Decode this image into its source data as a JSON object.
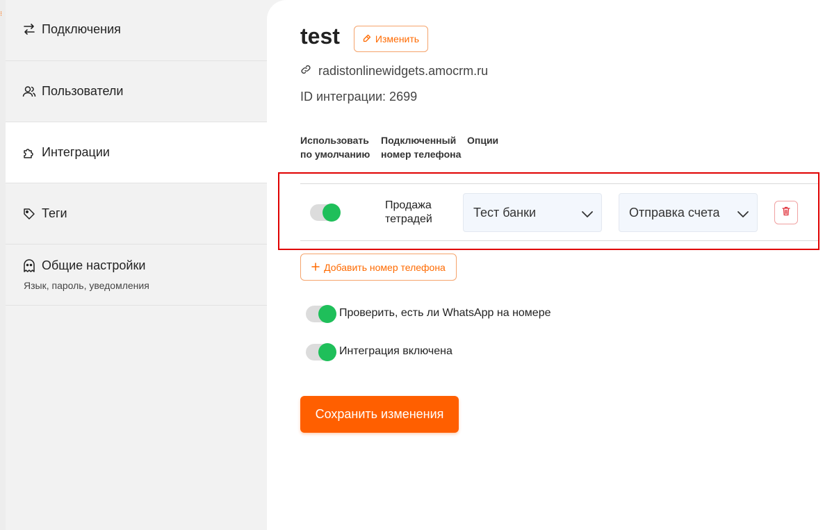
{
  "sidebar": {
    "items": [
      {
        "label": "Подключения",
        "icon": "arrows-exchange-icon"
      },
      {
        "label": "Пользователи",
        "icon": "users-icon"
      },
      {
        "label": "Интеграции",
        "icon": "puzzle-icon",
        "active": true
      },
      {
        "label": "Теги",
        "icon": "tag-icon"
      },
      {
        "label": "Общие настройки",
        "icon": "ghost-icon",
        "subtitle": "Язык, пароль, уведомления"
      }
    ]
  },
  "header": {
    "title": "test",
    "edit_label": "Изменить",
    "domain": "radistonlinewidgets.amocrm.ru",
    "integration_id": "ID интеграции: 2699"
  },
  "table": {
    "headers": {
      "default": "Использовать по умолчанию",
      "phone": "Подключенный номер телефона",
      "options": "Опции"
    },
    "rows": [
      {
        "default_on": true,
        "phone_name": "Продажа тетрадей",
        "option1": "Тест банки",
        "option2": "Отправка счета"
      }
    ]
  },
  "actions": {
    "add_phone_label": "Добавить номер телефона",
    "save_label": "Сохранить изменения"
  },
  "toggles": {
    "whatsapp_check": {
      "label": "Проверить, есть ли WhatsApp на номере",
      "on": true
    },
    "integration_enabled": {
      "label": "Интеграция включена",
      "on": true
    }
  },
  "colors": {
    "accent": "#ff5f00",
    "toggle_on": "#1fbf5a",
    "highlight": "#e00000"
  }
}
